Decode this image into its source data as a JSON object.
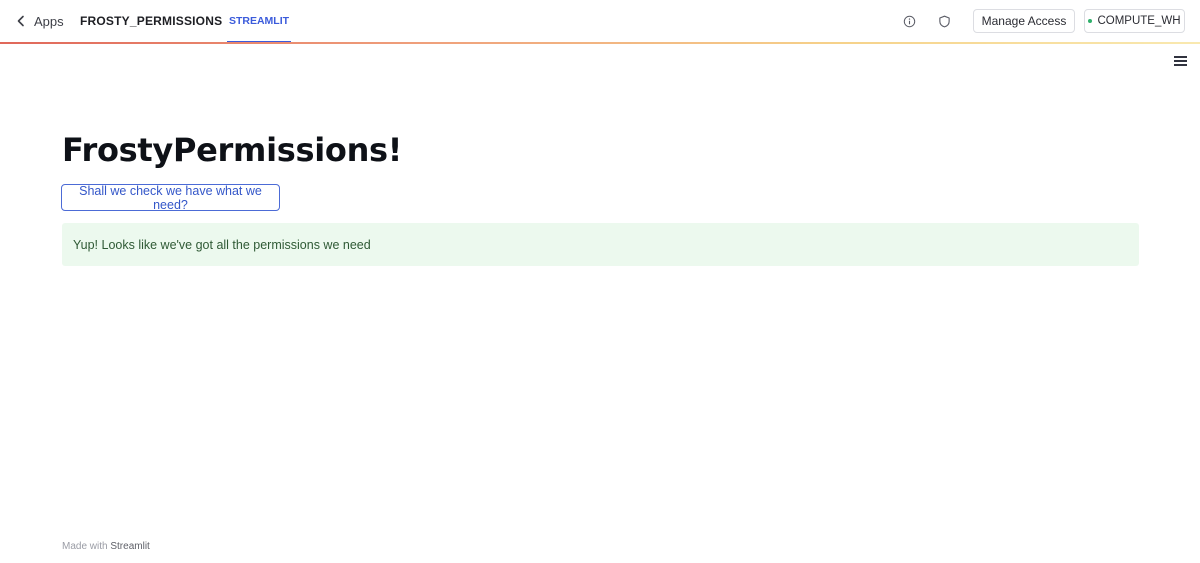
{
  "topbar": {
    "back_label": "Apps",
    "app_name": "FROSTY_PERMISSIONS",
    "tabs": [
      {
        "label": "STREAMLIT",
        "active": true
      }
    ],
    "info_icon": "info-icon",
    "shield_icon": "shield-icon",
    "manage_access_label": "Manage Access",
    "warehouse_label": "COMPUTE_WH",
    "warehouse_status_color": "#2fb06b"
  },
  "main": {
    "menu_icon": "hamburger-menu-icon",
    "title": "FrostyPermissions!",
    "check_button_label": "Shall we check we have what we need?",
    "success_message": "Yup! Looks like we've got all the permissions we need"
  },
  "footer": {
    "made_with": "Made with",
    "brand": "Streamlit"
  },
  "colors": {
    "accent": "#3b5bdb",
    "success_bg": "#ecf9ee",
    "success_text": "#2f5a35"
  }
}
